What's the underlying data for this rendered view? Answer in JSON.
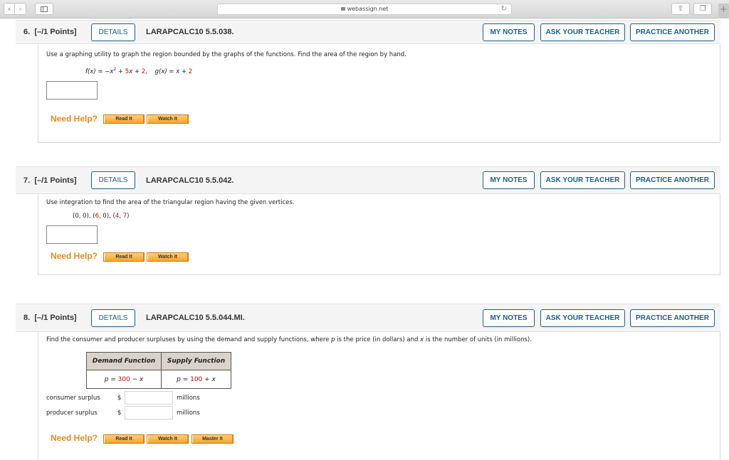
{
  "browser": {
    "url": "webassign.net",
    "icons": {
      "back": "chevron-left-icon",
      "forward": "chevron-right-icon",
      "sidebar": "sidebar-icon",
      "lock": "lock-icon",
      "reload": "reload-icon",
      "share": "share-icon",
      "tabs": "tabs-icon",
      "new_tab": "plus-icon"
    },
    "glyphs": {
      "back": "‹",
      "forward": "›",
      "reload": "↻",
      "share": "⇧",
      "tabs": "❐",
      "new_tab": "+"
    }
  },
  "common": {
    "details_label": "DETAILS",
    "my_notes_label": "MY NOTES",
    "ask_teacher_label": "ASK YOUR TEACHER",
    "practice_another_label": "PRACTICE ANOTHER",
    "need_help_label": "Need Help?",
    "read_it_label": "Read It",
    "watch_it_label": "Watch It",
    "master_it_label": "Master It"
  },
  "colors": {
    "accent_blue": "#1d5f8a",
    "help_orange": "#e58a1f",
    "highlight_red": "#d40000"
  },
  "questions": [
    {
      "number": "6.",
      "points": "[–/1 Points]",
      "code": "LARAPCALC10 5.5.038.",
      "prompt": "Use a graphing utility to graph the region bounded by the graphs of the functions. Find the area of the region by hand.",
      "math": {
        "f_label": "f(x) = −x",
        "f_exp": "2",
        "f_mid": " + ",
        "f_coef": "5",
        "f_x": "x + ",
        "f_const": "2",
        "sep": ",    ",
        "g_label": "g(x) = x + ",
        "g_const": "2"
      },
      "answer_value": ""
    },
    {
      "number": "7.",
      "points": "[–/1 Points]",
      "code": "LARAPCALC10 5.5.042.",
      "prompt": "Use integration to find the area of the triangular region having the given vertices.",
      "vertices": {
        "v1": "(0, 0), (",
        "a": "6",
        "v2": ", 0), (",
        "b": "4",
        "v3": ", ",
        "c": "7",
        "v4": ")"
      },
      "answer_value": ""
    },
    {
      "number": "8.",
      "points": "[–/1 Points]",
      "code": "LARAPCALC10 5.5.044.MI.",
      "prompt_pre": "Find the consumer and producer surpluses by using the demand and supply functions, where ",
      "prompt_p": "p",
      "prompt_mid": " is the price (in dollars) and ",
      "prompt_x": "x",
      "prompt_post": " is the number of units (in millions).",
      "table": {
        "headers": [
          "Demand Function",
          "Supply Function"
        ],
        "demand": {
          "lhs": "p",
          "eq": " = ",
          "val": "300",
          "rest": " − ",
          "var": "x"
        },
        "supply": {
          "lhs": "p",
          "eq": " = ",
          "val": "100",
          "rest": " + ",
          "var": "x"
        }
      },
      "rows": [
        {
          "label": "consumer surplus",
          "currency": "$",
          "value": "",
          "unit": "millions"
        },
        {
          "label": "producer surplus",
          "currency": "$",
          "value": "",
          "unit": "millions"
        }
      ]
    }
  ]
}
